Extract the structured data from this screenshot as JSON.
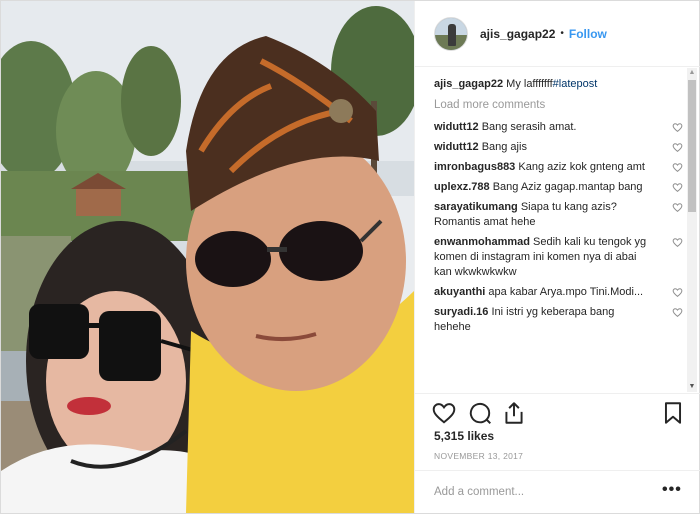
{
  "header": {
    "username": "ajis_gagap22",
    "separator": "•",
    "follow_label": "Follow"
  },
  "caption": {
    "username": "ajis_gagap22",
    "text": "My lafffffff",
    "hashtag": "#latepost"
  },
  "load_more_label": "Load more comments",
  "comments": [
    {
      "user": "widutt12",
      "text": "Bang serasih amat."
    },
    {
      "user": "widutt12",
      "text": "Bang ajis"
    },
    {
      "user": "imronbagus883",
      "text": "Kang aziz kok gnteng amt"
    },
    {
      "user": "uplexz.788",
      "text": "Bang Aziz gagap.mantap bang"
    },
    {
      "user": "sarayatikumang",
      "text": "Siapa tu kang azis? Romantis amat hehe"
    },
    {
      "user": "enwanmohammad",
      "text": "Sedih kali ku tengok yg komen di instagram ini komen nya di abai kan wkwkwkwkw"
    },
    {
      "user": "akuyanthi",
      "text": "apa kabar Arya.mpo Tini.Modi..."
    },
    {
      "user": "suryadi.16",
      "text": "Ini istri yg keberapa bang hehehe"
    }
  ],
  "icons": {
    "like": "heart-icon",
    "comment": "comment-icon",
    "share": "share-icon",
    "save": "bookmark-icon",
    "comment_like": "heart-icon",
    "more": "more-options-icon"
  },
  "likes_label": "5,315 likes",
  "date_label": "NOVEMBER 13, 2017",
  "add_comment": {
    "placeholder": "Add a comment...",
    "more_label": "•••"
  },
  "colors": {
    "accent": "#3897f0",
    "hashtag": "#003569",
    "muted": "#999999",
    "text": "#262626",
    "border": "#efefef"
  }
}
